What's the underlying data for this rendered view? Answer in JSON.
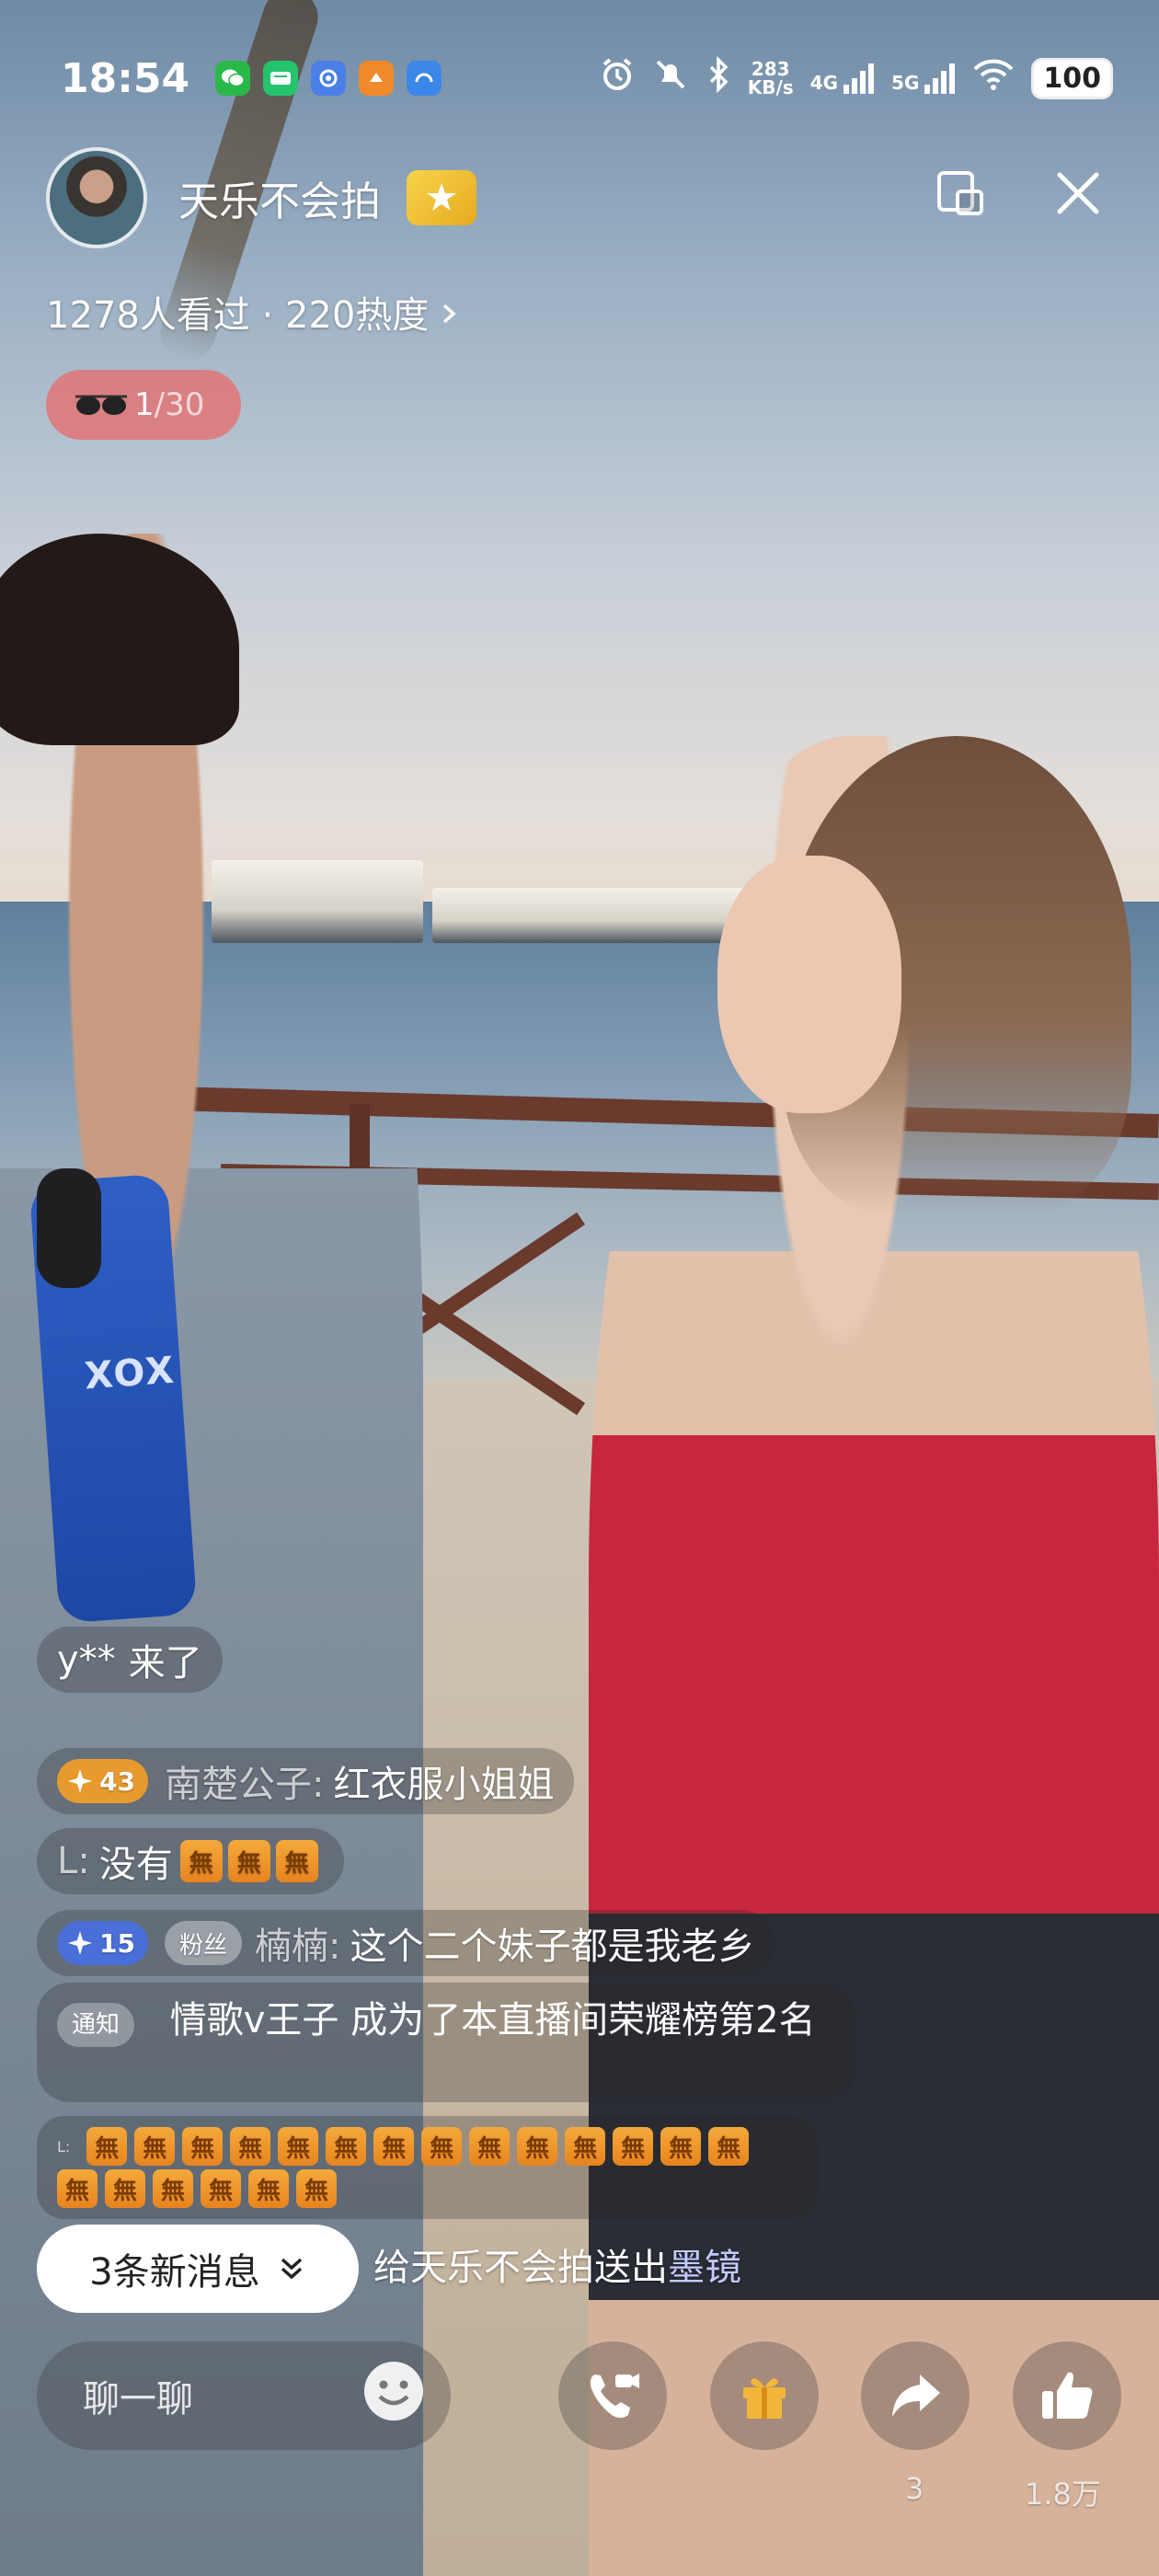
{
  "status_bar": {
    "time": "18:54",
    "net_speed_value": "283",
    "net_speed_unit": "KB/s",
    "net_1": "4G",
    "net_2": "5G",
    "battery": "100"
  },
  "header": {
    "host_name": "天乐不会拍",
    "viewers_text": "1278人看过 · 220热度",
    "rank_current": "1",
    "rank_total": "/30"
  },
  "chat": {
    "join_user": "y**",
    "join_text": "来了",
    "msg1": {
      "level": "43",
      "user": "南楚公子:",
      "text": "红衣服小姐姐"
    },
    "msg2": {
      "user": "L:",
      "text": "没有"
    },
    "msg3": {
      "level": "15",
      "fan_badge": "粉丝",
      "user": "楠楠:",
      "text": "这个二个妹子都是我老乡"
    },
    "notice": {
      "badge": "通知",
      "text": "情歌v王子 成为了本直播间荣耀榜第2名"
    },
    "msg4": {
      "user": "L:"
    },
    "wu_glyph": "無",
    "gift_text": "给天乐不会拍送出",
    "gift_name": "墨镜"
  },
  "new_messages_button": "3条新消息",
  "bottom_bar": {
    "input_placeholder": "聊一聊",
    "share_count": "3",
    "like_count": "1.8万"
  },
  "colors": {
    "level_43_badge": "#e79a2e",
    "level_15_badge": "#4a6fd8",
    "rank_pill": "#e66e6e",
    "host_badge": "#f0be32",
    "gift_name": "#c3cbff"
  }
}
